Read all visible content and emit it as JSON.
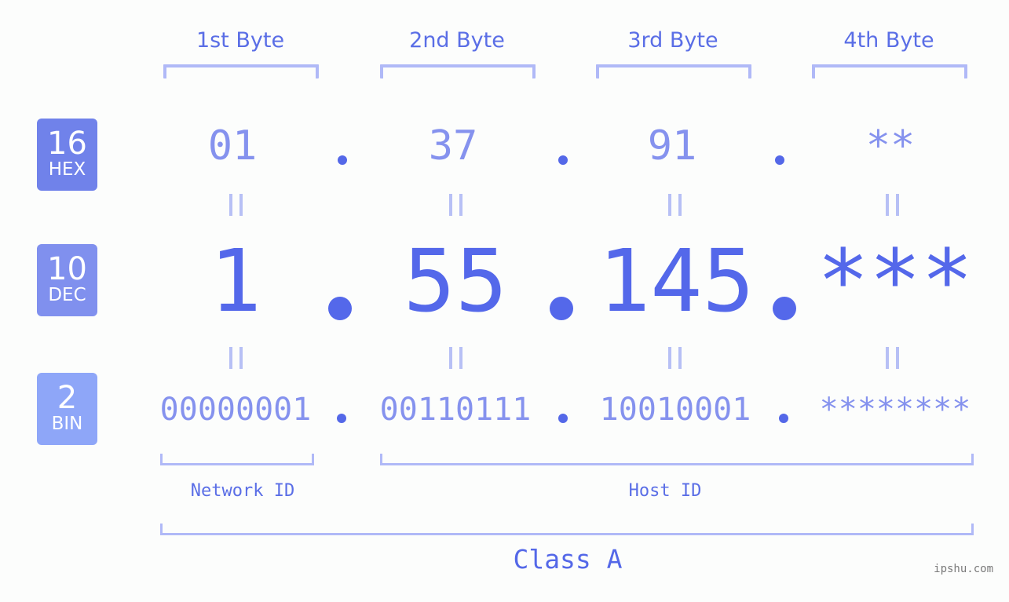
{
  "bytes": {
    "headers": [
      "1st Byte",
      "2nd Byte",
      "3rd Byte",
      "4th Byte"
    ]
  },
  "bases": [
    {
      "num": "16",
      "name": "HEX",
      "color": "#7082ea"
    },
    {
      "num": "10",
      "name": "DEC",
      "color": "#8090ee"
    },
    {
      "num": "2",
      "name": "BIN",
      "color": "#8ea6f8"
    }
  ],
  "hex": {
    "values": [
      "01",
      "37",
      "91",
      "**"
    ]
  },
  "dec": {
    "values": [
      "1",
      "55",
      "145",
      "***"
    ]
  },
  "bin": {
    "values": [
      "00000001",
      "00110111",
      "10010001",
      "********"
    ]
  },
  "ids": {
    "network_label": "Network ID",
    "host_label": "Host ID"
  },
  "class_label": "Class A",
  "watermark": "ipshu.com",
  "colors": {
    "primary": "#5468e8",
    "light": "#8592ee",
    "bracket": "#b0b9f7"
  }
}
